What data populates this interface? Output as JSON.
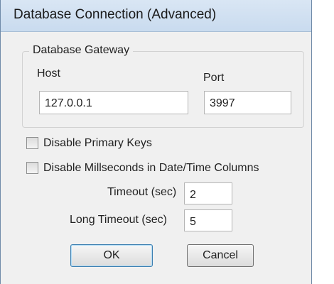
{
  "window": {
    "title": "Database Connection (Advanced)"
  },
  "gateway": {
    "group_title": "Database Gateway",
    "host_label": "Host",
    "host_value": "127.0.0.1",
    "port_label": "Port",
    "port_value": "3997"
  },
  "options": {
    "disable_primary_keys_label": "Disable Primary Keys",
    "disable_primary_keys_checked": false,
    "disable_milliseconds_label": "Disable Millseconds in Date/Time Columns",
    "disable_milliseconds_checked": false
  },
  "timeouts": {
    "timeout_label": "Timeout (sec)",
    "timeout_value": "2",
    "long_timeout_label": "Long Timeout (sec)",
    "long_timeout_value": "5"
  },
  "buttons": {
    "ok_label": "OK",
    "cancel_label": "Cancel"
  }
}
